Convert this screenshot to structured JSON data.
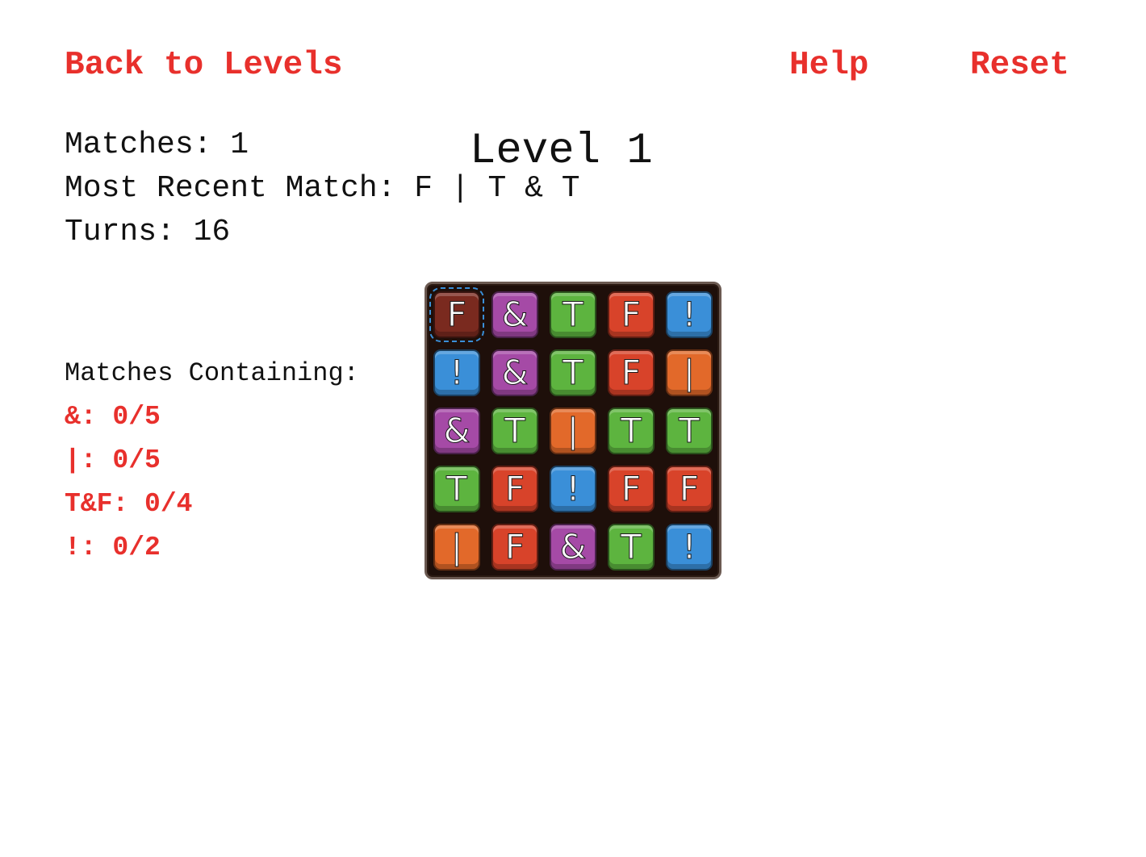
{
  "nav": {
    "back_label": "Back to Levels",
    "help_label": "Help",
    "reset_label": "Reset"
  },
  "stats": {
    "matches": "Matches: 1",
    "most_recent_match": "Most Recent Match: F | T & T",
    "turns": "Turns: 16"
  },
  "level_title": "Level 1",
  "goals": {
    "heading": "Matches Containing:",
    "items": [
      {
        "label": "&: 0/5"
      },
      {
        "label": "|: 0/5"
      },
      {
        "label": "T&F: 0/4"
      },
      {
        "label": "!: 0/2"
      }
    ]
  },
  "colors": {
    "link": "#e8302c",
    "T": "#5db43f",
    "F": "#d8432a",
    "&": "#a54aa6",
    "!": "#3a8fd8",
    "|": "#e2692a",
    "selected": "#7a2a1f",
    "board": "#1e0f0a"
  },
  "board": {
    "selected_cell": [
      0,
      0
    ],
    "rows": [
      [
        "F",
        "&",
        "T",
        "F",
        "!"
      ],
      [
        "!",
        "&",
        "T",
        "F",
        "|"
      ],
      [
        "&",
        "T",
        "|",
        "T",
        "T"
      ],
      [
        "T",
        "F",
        "!",
        "F",
        "F"
      ],
      [
        "|",
        "F",
        "&",
        "T",
        "!"
      ]
    ]
  }
}
